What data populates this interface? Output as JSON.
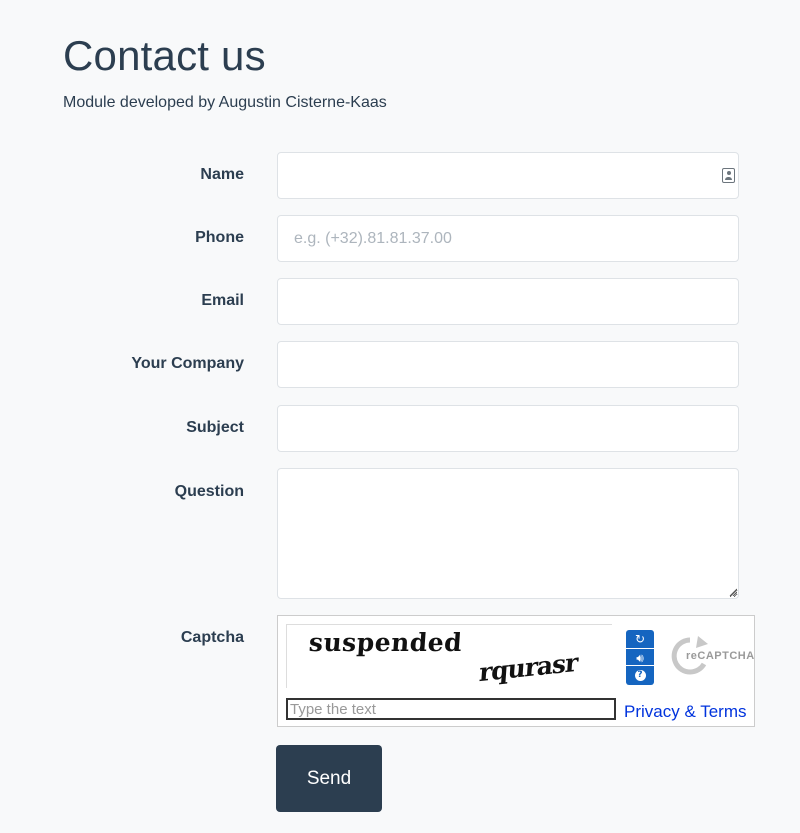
{
  "page": {
    "title": "Contact us",
    "subtitle": "Module developed by Augustin Cisterne-Kaas"
  },
  "form": {
    "name_label": "Name",
    "phone_label": "Phone",
    "phone_placeholder": "e.g. (+32).81.81.37.00",
    "email_label": "Email",
    "company_label": "Your Company",
    "subject_label": "Subject",
    "question_label": "Question",
    "captcha_label": "Captcha",
    "name_value": "",
    "email_value": "",
    "company_value": "",
    "subject_value": "",
    "question_value": "",
    "name_icon": "contact-card-icon"
  },
  "captcha": {
    "challenge_word_1": "suspended",
    "challenge_word_2": "rqurasr",
    "input_placeholder": "Type the text",
    "privacy_link": "Privacy & Terms",
    "logo_text": "reCAPTCHA",
    "controls": [
      "refresh-icon",
      "audio-icon",
      "help-icon"
    ],
    "controls_color": "#1565c0"
  },
  "actions": {
    "send_label": "Send"
  },
  "colors": {
    "primary": "#2c3e50",
    "link": "#0033dd",
    "background": "#f8f9fa"
  }
}
